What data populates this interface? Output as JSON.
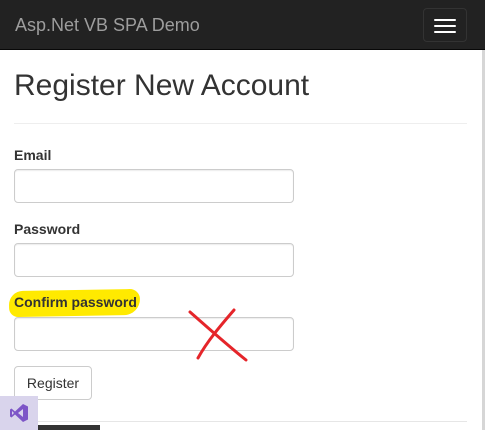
{
  "navbar": {
    "brand": "Asp.Net VB SPA Demo",
    "toggle_icon": "hamburger-menu-icon"
  },
  "page": {
    "title": "Register New Account"
  },
  "form": {
    "email_label": "Email",
    "email_value": "",
    "password_label": "Password",
    "password_value": "",
    "confirm_label": "Confirm password",
    "confirm_value": "",
    "register_label": "Register"
  },
  "annotations": {
    "highlight_color": "#ffea00",
    "cross_mark_color": "#e5252a"
  },
  "taskbar": {
    "app_icon": "visual-studio-icon",
    "app_icon_color": "#7d55c7"
  }
}
